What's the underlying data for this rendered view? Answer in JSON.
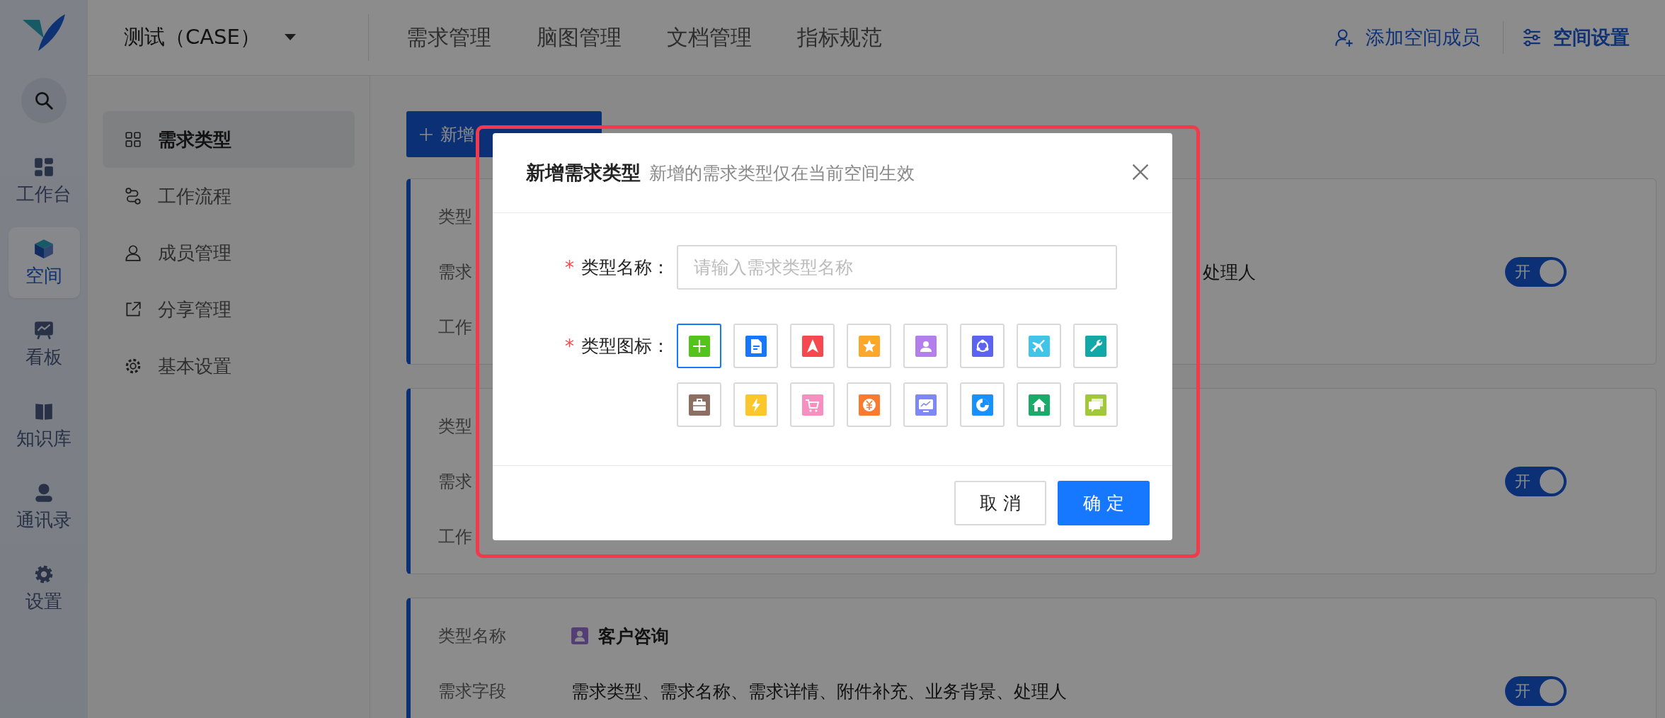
{
  "rail": {
    "items": [
      {
        "label": "工作台",
        "selected": false
      },
      {
        "label": "空间",
        "selected": true
      },
      {
        "label": "看板",
        "selected": false
      },
      {
        "label": "知识库",
        "selected": false
      },
      {
        "label": "通讯录",
        "selected": false
      },
      {
        "label": "设置",
        "selected": false
      }
    ]
  },
  "header": {
    "project": "测试（CASE）",
    "tabs": [
      "需求管理",
      "脑图管理",
      "文档管理",
      "指标规范"
    ],
    "add_member": "添加空间成员",
    "space_settings": "空间设置"
  },
  "subnav": {
    "items": [
      {
        "label": "需求类型",
        "selected": true
      },
      {
        "label": "工作流程",
        "selected": false
      },
      {
        "label": "成员管理",
        "selected": false
      },
      {
        "label": "分享管理",
        "selected": false
      },
      {
        "label": "基本设置",
        "selected": false
      }
    ]
  },
  "toolbar": {
    "add_button": "新增"
  },
  "cards": [
    {
      "rows": [
        {
          "label": "类型"
        },
        {
          "label": "需求",
          "kind": "tail",
          "value": "处理人"
        },
        {
          "label": "工作"
        }
      ],
      "toggle": {
        "on": true,
        "label": "开"
      }
    },
    {
      "rows": [
        {
          "label": "类型"
        },
        {
          "label": "需求"
        },
        {
          "label": "工作"
        }
      ],
      "toggle": {
        "on": true,
        "label": "开"
      }
    },
    {
      "rows": [
        {
          "label": "类型名称",
          "kind": "type",
          "value": "客户咨询"
        },
        {
          "label": "需求字段",
          "kind": "text",
          "value": "需求类型、需求名称、需求详情、附件补充、业务背景、处理人"
        }
      ],
      "toggle": {
        "on": true,
        "label": "开"
      }
    }
  ],
  "modal": {
    "title": "新增需求类型",
    "subtitle": "新增的需求类型仅在当前空间生效",
    "name_field": {
      "label": "类型名称：",
      "required_mark": "*",
      "placeholder": "请输入需求类型名称"
    },
    "icon_field": {
      "label": "类型图标：",
      "required_mark": "*"
    },
    "icons": [
      {
        "color": "#52c41a",
        "selected": true
      },
      {
        "color": "#1677ff",
        "selected": false
      },
      {
        "color": "#f5484f",
        "selected": false
      },
      {
        "color": "#faa72a",
        "selected": false
      },
      {
        "color": "#b37feb",
        "selected": false
      },
      {
        "color": "#5b63f0",
        "selected": false
      },
      {
        "color": "#40c4e8",
        "selected": false
      },
      {
        "color": "#13a8a8",
        "selected": false
      },
      {
        "color": "#8d6e63",
        "selected": false
      },
      {
        "color": "#fcc72a",
        "selected": false
      },
      {
        "color": "#f78fc0",
        "selected": false
      },
      {
        "color": "#fa7b30",
        "selected": false
      },
      {
        "color": "#7d87f5",
        "selected": false
      },
      {
        "color": "#1890ff",
        "selected": false
      },
      {
        "color": "#1aaa6a",
        "selected": false
      },
      {
        "color": "#a0c83a",
        "selected": false
      }
    ],
    "cancel": "取 消",
    "confirm": "确 定"
  }
}
